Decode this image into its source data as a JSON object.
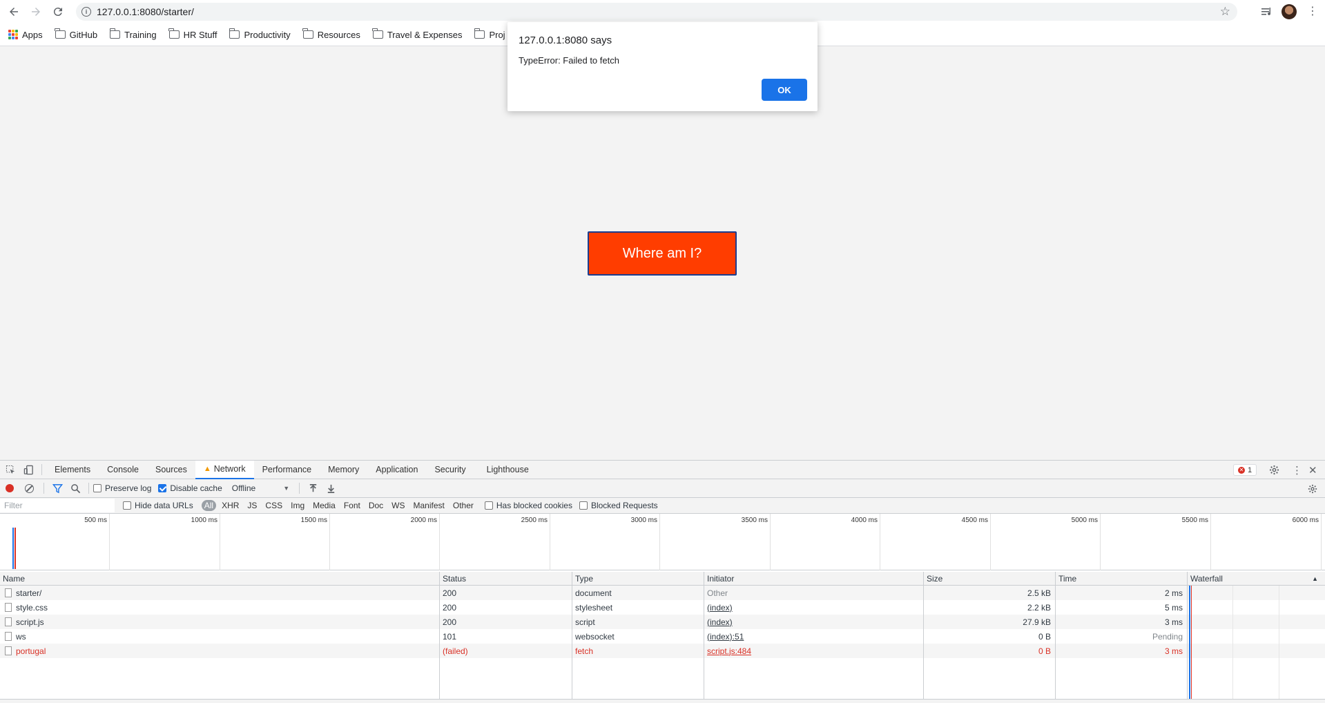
{
  "browser": {
    "url": "127.0.0.1:8080/starter/",
    "bookmarks": [
      "Apps",
      "GitHub",
      "Training",
      "HR Stuff",
      "Productivity",
      "Resources",
      "Travel & Expenses",
      "Proj"
    ]
  },
  "page": {
    "button_label": "Where am I?"
  },
  "dialog": {
    "title": "127.0.0.1:8080 says",
    "message": "TypeError: Failed to fetch",
    "ok_label": "OK"
  },
  "devtools": {
    "tabs": [
      "Elements",
      "Console",
      "Sources",
      "Network",
      "Performance",
      "Memory",
      "Application",
      "Security",
      "Lighthouse"
    ],
    "active_tab": "Network",
    "error_count": "1",
    "toolbar": {
      "preserve_log": "Preserve log",
      "disable_cache": "Disable cache",
      "throttling": "Offline"
    },
    "filter": {
      "placeholder": "Filter",
      "hide_data_urls": "Hide data URLs",
      "types": [
        "All",
        "XHR",
        "JS",
        "CSS",
        "Img",
        "Media",
        "Font",
        "Doc",
        "WS",
        "Manifest",
        "Other"
      ],
      "has_blocked_cookies": "Has blocked cookies",
      "blocked_requests": "Blocked Requests"
    },
    "timeline_ticks": [
      "500 ms",
      "1000 ms",
      "1500 ms",
      "2000 ms",
      "2500 ms",
      "3000 ms",
      "3500 ms",
      "4000 ms",
      "4500 ms",
      "5000 ms",
      "5500 ms",
      "6000 ms"
    ],
    "columns": [
      "Name",
      "Status",
      "Type",
      "Initiator",
      "Size",
      "Time",
      "Waterfall"
    ],
    "requests": [
      {
        "name": "starter/",
        "status": "200",
        "type": "document",
        "initiator": "Other",
        "size": "2.5 kB",
        "time": "2 ms"
      },
      {
        "name": "style.css",
        "status": "200",
        "type": "stylesheet",
        "initiator": "(index)",
        "size": "2.2 kB",
        "time": "5 ms"
      },
      {
        "name": "script.js",
        "status": "200",
        "type": "script",
        "initiator": "(index)",
        "size": "27.9 kB",
        "time": "3 ms"
      },
      {
        "name": "ws",
        "status": "101",
        "type": "websocket",
        "initiator": "(index):51",
        "size": "0 B",
        "time": "Pending"
      },
      {
        "name": "portugal",
        "status": "(failed)",
        "type": "fetch",
        "initiator": "script.js:484",
        "size": "0 B",
        "time": "3 ms"
      }
    ]
  },
  "colors": {
    "button_bg": "#ff3d00",
    "button_border": "#1a3d8f",
    "dialog_ok": "#1a73e8",
    "error_red": "#d93025"
  }
}
